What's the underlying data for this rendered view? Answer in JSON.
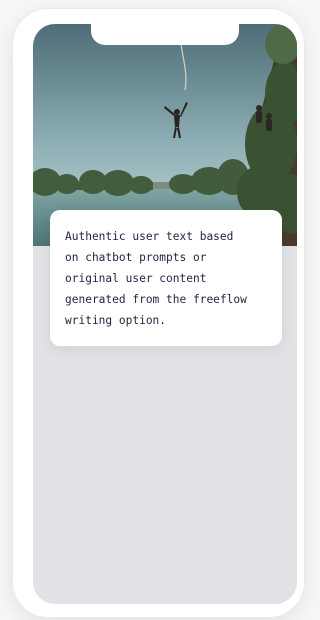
{
  "card": {
    "text": "Authentic user text based\non chatbot prompts or\noriginal user content\ngenerated from the freeflow\nwriting option."
  },
  "scene": {
    "colors": {
      "sky_top": "#50707a",
      "sky_bottom": "#bcd0d2",
      "water": "#5c7f7f",
      "trees": "#3f5a3a",
      "screen_bg": "#e1e2e6",
      "text": "#1f2340"
    },
    "icons": [
      "rope-swing-jumper-illustration"
    ]
  }
}
